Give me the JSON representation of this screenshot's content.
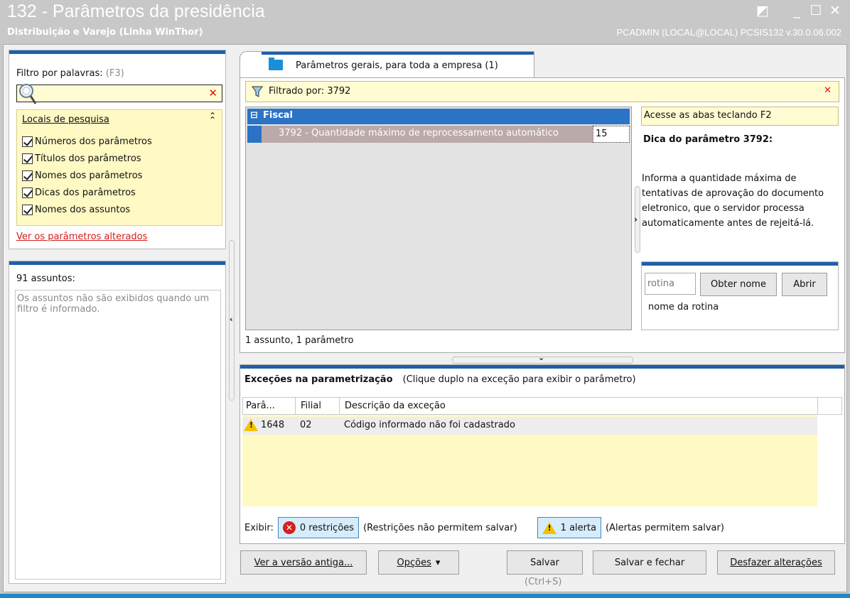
{
  "window": {
    "title": "132 - Parâmetros da presidência",
    "subtitle": "Distribuição e Varejo (Linha WinThor)",
    "session": "PCADMIN (LOCAL@LOCAL)   PCSIS132  v.30.0.06.002",
    "controls": {
      "restore": "◩",
      "minimize": "_",
      "maximize": "☐",
      "close": "✕"
    }
  },
  "filter": {
    "label": "Filtro por palavras:",
    "shortcut": "(F3)",
    "search_value": "",
    "search_placeholder": "",
    "clear": "✕"
  },
  "locais": {
    "title": "Locais de pesquisa",
    "collapse_glyph": "⌃",
    "options": [
      {
        "label": "Números dos parâmetros",
        "checked": true
      },
      {
        "label": "Títulos dos parâmetros",
        "checked": true
      },
      {
        "label": "Nomes dos parâmetros",
        "checked": true
      },
      {
        "label": "Dicas dos parâmetros",
        "checked": true
      },
      {
        "label": "Nomes dos assuntos",
        "checked": true
      }
    ]
  },
  "changed_link": "Ver os parâmetros alterados",
  "assuntos": {
    "count_label": "91 assuntos:",
    "empty_message": "Os assuntos não são exibidos quando um filtro é informado."
  },
  "tab": {
    "label": "Parâmetros gerais, para toda a empresa  (1)"
  },
  "filtered_bar": {
    "text": "Filtrado por: 3792",
    "close": "✕"
  },
  "tree": {
    "group": {
      "toggle": "⊟",
      "label": "Fiscal"
    },
    "rows": [
      {
        "label": "3792 - Quantidade máximo de reprocessamento automático",
        "value": "15"
      }
    ],
    "status": "1 assunto, 1 parâmetro"
  },
  "hint": {
    "access": "Acesse as abas teclando F2",
    "title": "Dica do parâmetro 3792:",
    "text": "Informa a quantidade máxima de tentativas de aprovação do documento eletronico, que o servidor processa automaticamente antes de rejeitá-lá."
  },
  "rotina": {
    "placeholder": "rotina",
    "obter_button": "Obter nome",
    "abrir_button": "Abrir",
    "nome_label": "nome da rotina"
  },
  "exceptions": {
    "title": "Exceções na parametrização",
    "instructions": "(Clique duplo na exceção para exibir o parâmetro)",
    "columns": [
      "Parâ...",
      "Filial",
      "Descrição da exceção"
    ],
    "rows": [
      {
        "param": "1648",
        "filial": "02",
        "descricao": "Código informado não foi cadastrado",
        "type": "alert"
      }
    ],
    "show_label": "Exibir:",
    "restrictions_button": "0 restrições",
    "restrictions_note": "(Restrições não permitem salvar)",
    "alerts_button": "1 alerta",
    "alerts_note": "(Alertas permitem salvar)"
  },
  "actions": {
    "old_version": "Ver a versão antiga...",
    "options": "Opções",
    "options_arrow": "▾",
    "save": "Salvar",
    "save_hint": "(Ctrl+S)",
    "save_close": "Salvar e fechar",
    "undo": "Desfazer alterações"
  },
  "colors": {
    "accent": "#1f5fa8",
    "tree_header": "#2b73c5",
    "highlight_yellow": "#fff9c4",
    "link_red": "#d41c1c"
  }
}
